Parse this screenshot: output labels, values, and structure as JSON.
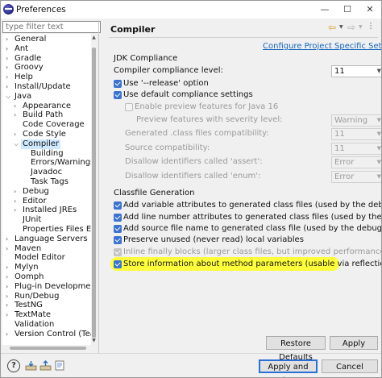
{
  "window": {
    "title": "Preferences",
    "min_glyph": "—",
    "max_glyph": "☐",
    "close_glyph": "✕"
  },
  "filter": {
    "placeholder": "type filter text"
  },
  "tree": [
    {
      "label": "General",
      "level": 0,
      "twisty": "collapsed"
    },
    {
      "label": "Ant",
      "level": 0,
      "twisty": "collapsed"
    },
    {
      "label": "Gradle",
      "level": 0,
      "twisty": "collapsed"
    },
    {
      "label": "Groovy",
      "level": 0,
      "twisty": "collapsed"
    },
    {
      "label": "Help",
      "level": 0,
      "twisty": "collapsed"
    },
    {
      "label": "Install/Update",
      "level": 0,
      "twisty": "collapsed"
    },
    {
      "label": "Java",
      "level": 0,
      "twisty": "expanded"
    },
    {
      "label": "Appearance",
      "level": 1,
      "twisty": "collapsed"
    },
    {
      "label": "Build Path",
      "level": 1,
      "twisty": "collapsed"
    },
    {
      "label": "Code Coverage",
      "level": 1,
      "twisty": "none"
    },
    {
      "label": "Code Style",
      "level": 1,
      "twisty": "collapsed"
    },
    {
      "label": "Compiler",
      "level": 1,
      "twisty": "expanded",
      "selected": true
    },
    {
      "label": "Building",
      "level": 2,
      "twisty": "none"
    },
    {
      "label": "Errors/Warnings",
      "level": 2,
      "twisty": "none"
    },
    {
      "label": "Javadoc",
      "level": 2,
      "twisty": "none"
    },
    {
      "label": "Task Tags",
      "level": 2,
      "twisty": "none"
    },
    {
      "label": "Debug",
      "level": 1,
      "twisty": "collapsed"
    },
    {
      "label": "Editor",
      "level": 1,
      "twisty": "collapsed"
    },
    {
      "label": "Installed JREs",
      "level": 1,
      "twisty": "collapsed"
    },
    {
      "label": "JUnit",
      "level": 1,
      "twisty": "none"
    },
    {
      "label": "Properties Files Edito",
      "level": 1,
      "twisty": "none"
    },
    {
      "label": "Language Servers",
      "level": 0,
      "twisty": "collapsed"
    },
    {
      "label": "Maven",
      "level": 0,
      "twisty": "collapsed"
    },
    {
      "label": "Model Editor",
      "level": 0,
      "twisty": "none"
    },
    {
      "label": "Mylyn",
      "level": 0,
      "twisty": "collapsed"
    },
    {
      "label": "Oomph",
      "level": 0,
      "twisty": "collapsed"
    },
    {
      "label": "Plug-in Development",
      "level": 0,
      "twisty": "collapsed"
    },
    {
      "label": "Run/Debug",
      "level": 0,
      "twisty": "collapsed"
    },
    {
      "label": "TestNG",
      "level": 0,
      "twisty": "collapsed"
    },
    {
      "label": "TextMate",
      "level": 0,
      "twisty": "collapsed"
    },
    {
      "label": "Validation",
      "level": 0,
      "twisty": "none"
    },
    {
      "label": "Version Control (Team)",
      "level": 0,
      "twisty": "collapsed"
    }
  ],
  "page": {
    "title": "Compiler",
    "config_link": "Configure Project Specific Settings...",
    "jdk_group": "JDK Compliance",
    "compliance_label": "Compiler compliance level:",
    "compliance_value": "11",
    "release_option": {
      "label": "Use '--release' option",
      "checked": true
    },
    "default_compliance": {
      "label": "Use default compliance settings",
      "checked": true
    },
    "preview_features": {
      "label": "Enable preview features for Java 16",
      "checked": false,
      "disabled": true
    },
    "severity_label": "Preview features with severity level:",
    "severity_value": "Warning",
    "generated_compat_label": "Generated .class files compatibility:",
    "generated_compat_value": "11",
    "source_compat_label": "Source compatibility:",
    "source_compat_value": "11",
    "assert_label": "Disallow identifiers called 'assert':",
    "assert_value": "Error",
    "enum_label": "Disallow identifiers called 'enum':",
    "enum_value": "Error",
    "classfile_group": "Classfile Generation",
    "classfile_options": [
      {
        "label": "Add variable attributes to generated class files (used by the debugger)",
        "checked": true,
        "disabled": false
      },
      {
        "label": "Add line number attributes to generated class files (used by the debugger)",
        "checked": true,
        "disabled": false
      },
      {
        "label": "Add source file name to generated class file (used by the debugger)",
        "checked": true,
        "disabled": false
      },
      {
        "label": "Preserve unused (never read) local variables",
        "checked": true,
        "disabled": false
      },
      {
        "label": "Inline finally blocks (larger class files, but improved performance)",
        "checked": true,
        "disabled": true
      },
      {
        "label": "Store information about method parameters (usable via reflection)",
        "checked": true,
        "disabled": false,
        "highlighted": true
      }
    ],
    "highlight_color": "#ffff3c",
    "restore_defaults": "Restore Defaults",
    "apply": "Apply"
  },
  "footer": {
    "help": "?",
    "apply_and_close": "Apply and Close",
    "cancel": "Cancel"
  }
}
